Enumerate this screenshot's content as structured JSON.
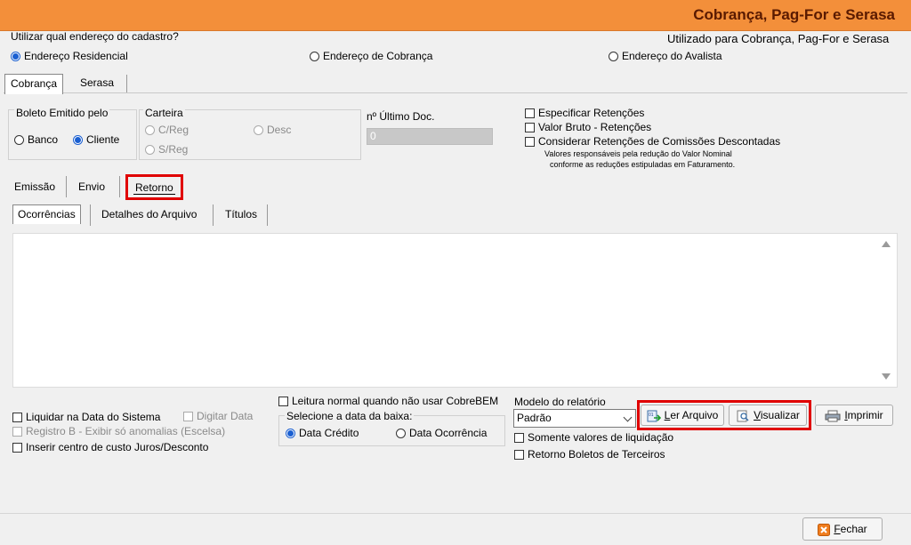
{
  "window": {
    "title": "Cobrança, Pag-For e Serasa"
  },
  "address": {
    "question": "Utilizar qual endereço do cadastro?",
    "used_for": "Utilizado para Cobrança, Pag-For e Serasa",
    "options": [
      "Endereço Residencial",
      "Endereço de Cobrança",
      "Endereço do Avalista"
    ],
    "selected": "Endereço Residencial"
  },
  "main_tabs": [
    "Cobrança",
    "Serasa"
  ],
  "boleto": {
    "label": "Boleto Emitido pelo",
    "options": [
      "Banco",
      "Cliente"
    ],
    "selected": "Cliente"
  },
  "carteira": {
    "label": "Carteira",
    "options": [
      "C/Reg",
      "Desc",
      "S/Reg"
    ]
  },
  "ultimo_doc": {
    "label": "nº Último Doc.",
    "value": "0"
  },
  "retencoes": {
    "especificar": "Especificar Retenções",
    "valor_bruto": "Valor Bruto - Retenções",
    "considerar": "Considerar Retenções de Comissões Descontadas",
    "note_line1": "Valores responsáveis pela redução do Valor Nominal",
    "note_line2": "conforme as reduções estipuladas em Faturamento."
  },
  "sub_tabs": [
    "Emissão",
    "Envio",
    "Retorno"
  ],
  "retorno_tabs": [
    "Ocorrências",
    "Detalhes do Arquivo",
    "Títulos"
  ],
  "options_left": {
    "liquidar": "Liquidar na Data do Sistema",
    "digitar": "Digitar Data",
    "registro_b": "Registro B - Exibir só anomalias (Escelsa)",
    "centro_custo": "Inserir centro de custo Juros/Desconto"
  },
  "baixa": {
    "leitura": "Leitura normal quando não usar CobreBEM",
    "label": "Selecione a data da baixa:",
    "options": [
      "Data Crédito",
      "Data Ocorrência"
    ],
    "selected": "Data Crédito"
  },
  "relatorio": {
    "label": "Modelo do relatório",
    "value": "Padrão",
    "somente": "Somente valores de liquidação",
    "terceiros": "Retorno Boletos de Terceiros"
  },
  "buttons": {
    "ler_prefix": "L",
    "ler_rest": "er Arquivo",
    "vis_prefix": "V",
    "vis_rest": "isualizar",
    "imp_prefix": "I",
    "imp_rest": "mprimir",
    "fechar_prefix": "F",
    "fechar_rest": "echar"
  },
  "colors": {
    "title_bar": "#f38f3a",
    "highlight": "#e00000",
    "radio_selected": "#1a5fd1"
  }
}
